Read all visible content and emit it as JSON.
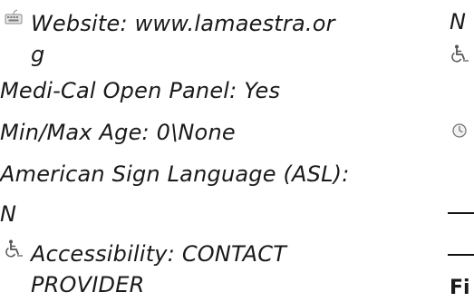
{
  "left_column": {
    "website": "Website: www.lamaestra.or",
    "website_wrap": "g",
    "medi_cal": "Medi-Cal Open Panel: Yes",
    "age": "Min/Max Age: 0\\None",
    "asl": "American Sign Language (ASL):",
    "asl_value": "N",
    "accessibility": "Accessibility: CONTACT",
    "accessibility_wrap": "PROVIDER"
  },
  "right_column": {
    "n_value": "N",
    "heading_fragment": "Fi"
  },
  "icons": {
    "website": "keyboard-icon",
    "accessibility": "wheelchair-icon",
    "right_accessibility": "wheelchair-icon",
    "right_clock": "clock-icon"
  }
}
